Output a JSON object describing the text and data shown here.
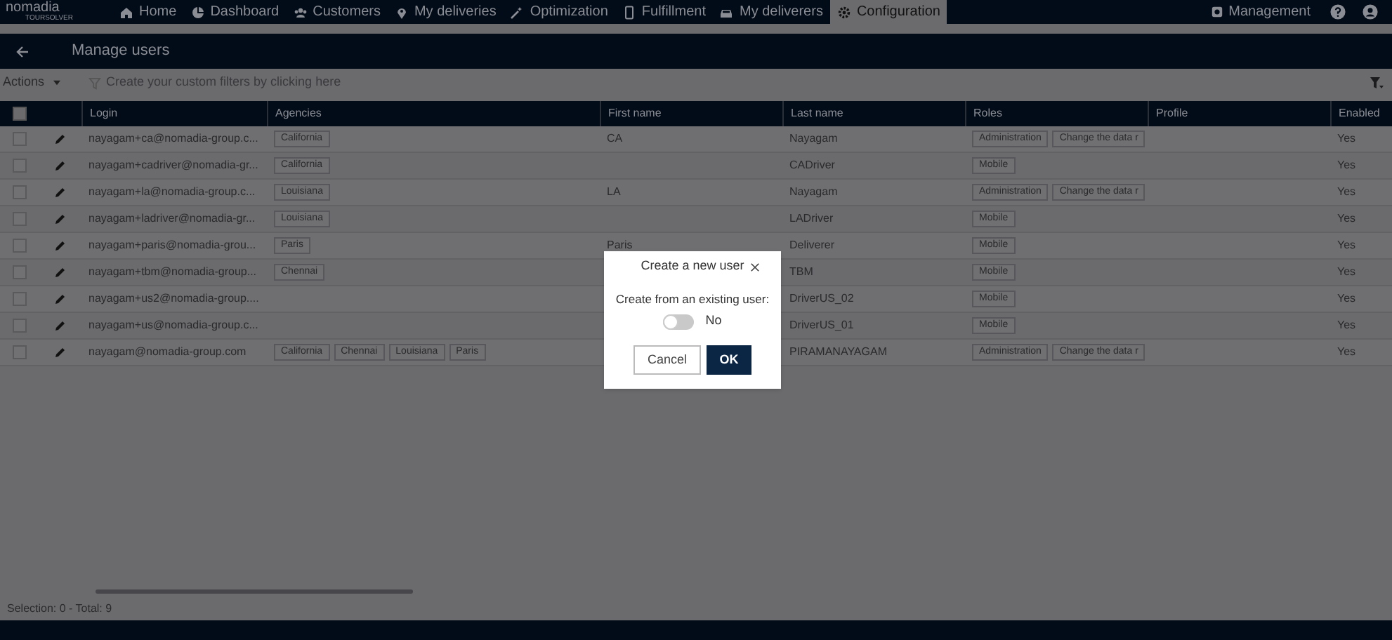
{
  "logo": {
    "name": "nomadia",
    "product": "TOURSOLVER"
  },
  "nav": [
    {
      "label": "Home",
      "selected": false
    },
    {
      "label": "Dashboard",
      "selected": false
    },
    {
      "label": "Customers",
      "selected": false
    },
    {
      "label": "My deliveries",
      "selected": false
    },
    {
      "label": "Optimization",
      "selected": false
    },
    {
      "label": "Fulfillment",
      "selected": false
    },
    {
      "label": "My deliverers",
      "selected": false
    },
    {
      "label": "Configuration",
      "selected": true
    }
  ],
  "nav_right": {
    "label": "Management"
  },
  "page_title": "Manage users",
  "toolbar": {
    "actions": "Actions",
    "filter_placeholder": "Create your custom filters by clicking here"
  },
  "table": {
    "all_selected": false,
    "columns": [
      "Login",
      "Agencies",
      "First name",
      "Last name",
      "Roles",
      "Profile",
      "Enabled"
    ],
    "rows": [
      {
        "checked": false,
        "login": "nayagam+ca@nomadia-group.c...",
        "agencies": [
          "California"
        ],
        "first_name": "CA",
        "last_name": "Nayagam",
        "roles": [
          "Administration",
          "Change the data r"
        ],
        "enabled": "Yes"
      },
      {
        "checked": false,
        "login": "nayagam+cadriver@nomadia-gr...",
        "agencies": [
          "California"
        ],
        "first_name": "",
        "last_name": "CADriver",
        "roles": [
          "Mobile"
        ],
        "enabled": "Yes"
      },
      {
        "checked": false,
        "login": "nayagam+la@nomadia-group.c...",
        "agencies": [
          "Louisiana"
        ],
        "first_name": "LA",
        "last_name": "Nayagam",
        "roles": [
          "Administration",
          "Change the data r"
        ],
        "enabled": "Yes"
      },
      {
        "checked": false,
        "login": "nayagam+ladriver@nomadia-gr...",
        "agencies": [
          "Louisiana"
        ],
        "first_name": "",
        "last_name": "LADriver",
        "roles": [
          "Mobile"
        ],
        "enabled": "Yes"
      },
      {
        "checked": false,
        "login": "nayagam+paris@nomadia-grou...",
        "agencies": [
          "Paris"
        ],
        "first_name": "Paris",
        "last_name": "Deliverer",
        "roles": [
          "Mobile"
        ],
        "enabled": "Yes"
      },
      {
        "checked": false,
        "login": "nayagam+tbm@nomadia-group...",
        "agencies": [
          "Chennai"
        ],
        "first_name": "",
        "last_name": "TBM",
        "roles": [
          "Mobile"
        ],
        "enabled": "Yes"
      },
      {
        "checked": false,
        "login": "nayagam+us2@nomadia-group....",
        "agencies": [],
        "first_name": "",
        "last_name": "DriverUS_02",
        "roles": [
          "Mobile"
        ],
        "enabled": "Yes"
      },
      {
        "checked": false,
        "login": "nayagam+us@nomadia-group.c...",
        "agencies": [],
        "first_name": "",
        "last_name": "DriverUS_01",
        "roles": [
          "Mobile"
        ],
        "enabled": "Yes"
      },
      {
        "checked": false,
        "login": "nayagam@nomadia-group.com",
        "agencies": [
          "California",
          "Chennai",
          "Louisiana",
          "Paris"
        ],
        "first_name": "",
        "last_name": "PIRAMANAYAGAM",
        "roles": [
          "Administration",
          "Change the data r"
        ],
        "enabled": "Yes"
      }
    ]
  },
  "status_bar": "Selection: 0 - Total: 9",
  "dialog": {
    "title": "Create a new user",
    "label": "Create from an existing user:",
    "toggle": {
      "on": false,
      "label": "No"
    },
    "buttons": [
      {
        "label": "Cancel",
        "kind": "secondary"
      },
      {
        "label": "OK",
        "kind": "primary"
      }
    ]
  }
}
